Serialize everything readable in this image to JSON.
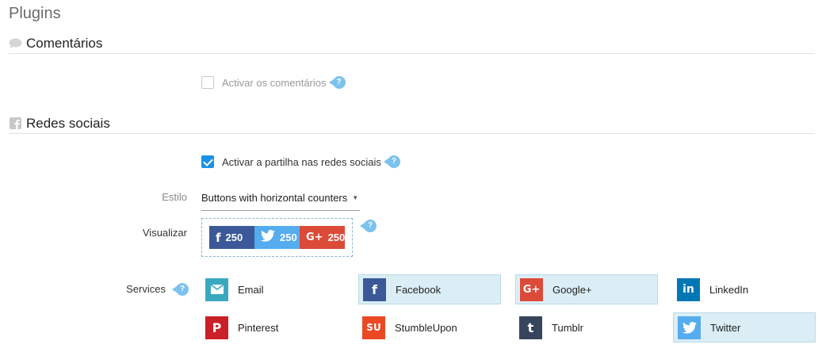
{
  "page": {
    "title": "Plugins"
  },
  "comments": {
    "section_title": "Comentários",
    "enable_label": "Activar os comentários",
    "enabled": false
  },
  "social": {
    "section_title": "Redes sociais",
    "enable_label": "Activar a partilha nas redes sociais",
    "enabled": true,
    "style_label": "Estilo",
    "style_value": "Buttons with horizontal counters",
    "preview_label": "Visualizar",
    "preview": {
      "facebook_count": "250",
      "twitter_count": "250",
      "googleplus_count": "250"
    },
    "services_label": "Services",
    "services": [
      {
        "label": "Email",
        "icon": "email-icon",
        "color": "#3aa9c0",
        "active": false
      },
      {
        "label": "Facebook",
        "icon": "facebook-icon",
        "color": "#3b5998",
        "active": true
      },
      {
        "label": "Google+",
        "icon": "google-plus-icon",
        "color": "#dc4a38",
        "active": true
      },
      {
        "label": "LinkedIn",
        "icon": "linkedin-icon",
        "color": "#0077b5",
        "active": false
      },
      {
        "label": "Pinterest",
        "icon": "pinterest-icon",
        "color": "#cb2027",
        "active": false
      },
      {
        "label": "StumbleUpon",
        "icon": "stumbleupon-icon",
        "color": "#eb4924",
        "active": false
      },
      {
        "label": "Tumblr",
        "icon": "tumblr-icon",
        "color": "#35465c",
        "active": false
      },
      {
        "label": "Twitter",
        "icon": "twitter-icon",
        "color": "#55acee",
        "active": true
      }
    ]
  }
}
